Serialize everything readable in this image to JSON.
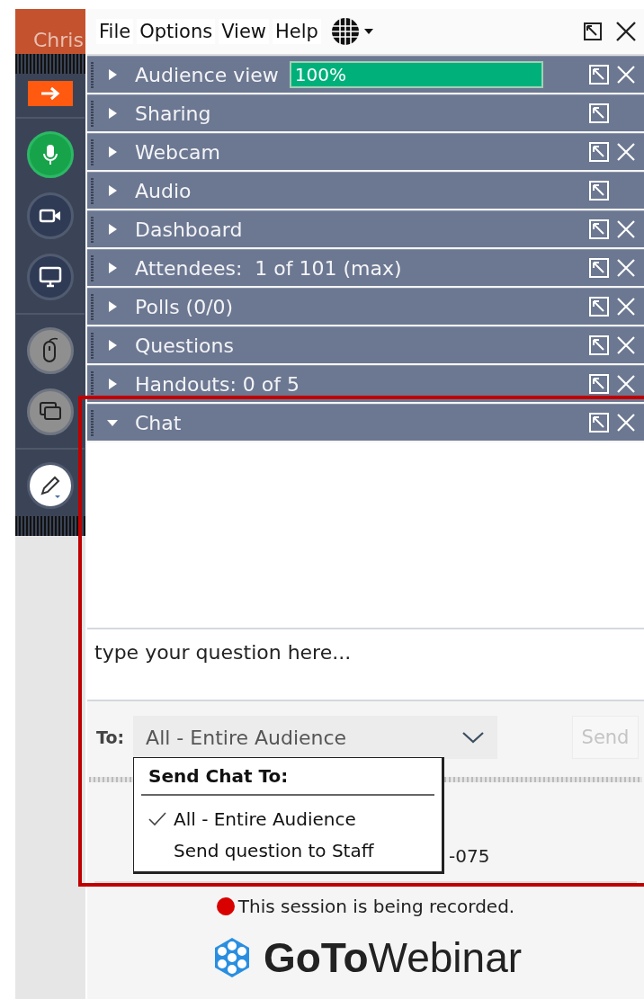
{
  "sidebar": {
    "user": "Chris",
    "tools": [
      {
        "kind": "arrow"
      },
      {
        "kind": "mic",
        "on": true
      },
      {
        "kind": "webcam",
        "on": false
      },
      {
        "kind": "screen",
        "on": false
      },
      {
        "kind": "mouse",
        "disabled": true
      },
      {
        "kind": "windows",
        "disabled": true
      },
      {
        "kind": "pen"
      }
    ]
  },
  "menu": [
    "File",
    "Options",
    "View",
    "Help"
  ],
  "panels": [
    {
      "title": "Audience view",
      "expanded": false,
      "closable": true,
      "level": 1,
      "reading": "100%"
    },
    {
      "title": "Sharing",
      "expanded": false,
      "closable": false
    },
    {
      "title": "Webcam",
      "expanded": false,
      "closable": true
    },
    {
      "title": "Audio",
      "expanded": false,
      "closable": false
    },
    {
      "title": "Dashboard",
      "expanded": false,
      "closable": true
    },
    {
      "title": "Attendees:  1 of 101 (max)",
      "expanded": false,
      "closable": true
    },
    {
      "title": "Polls (0/0)",
      "expanded": false,
      "closable": true
    },
    {
      "title": "Questions",
      "expanded": false,
      "closable": true
    },
    {
      "title": "Handouts: 0 of 5",
      "expanded": false,
      "closable": true
    },
    {
      "title": "Chat",
      "expanded": true,
      "closable": true
    }
  ],
  "chat": {
    "placeholder": "type your question here...",
    "to_label": "To:",
    "recipient": "All - Entire Audience",
    "send": {
      "label": "Send",
      "disabled": true
    },
    "menu": {
      "title": "Send Chat To:",
      "options": [
        {
          "label": "All - Entire Audience",
          "selected": true
        },
        {
          "label": "Send question to Staff",
          "selected": false
        }
      ]
    }
  },
  "info_fragment": "-075",
  "recording": "This session is being recorded.",
  "logo": "**GoTo**Webinar"
}
